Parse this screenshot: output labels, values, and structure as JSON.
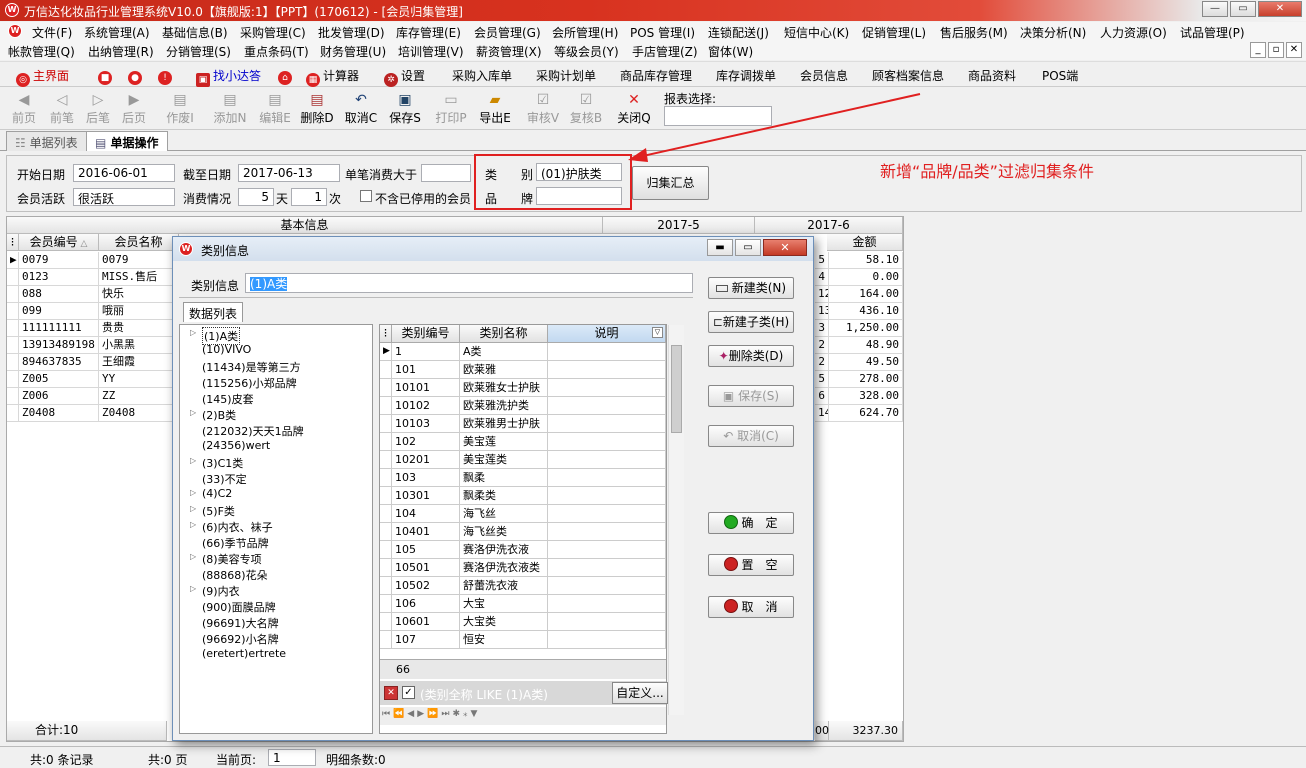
{
  "window": {
    "title": "万信达化妆品行业管理系统V10.0【旗舰版:1】【PPT】(170612) - [会员归集管理]",
    "controls": [
      "—",
      "▭",
      "✕"
    ]
  },
  "menu1": [
    "文件(F)",
    "系统管理(A)",
    "基础信息(B)",
    "采购管理(C)",
    "批发管理(D)",
    "库存管理(E)",
    "会员管理(G)",
    "会所管理(H)",
    "POS 管理(I)",
    "连锁配送(J)",
    "短信中心(K)",
    "促销管理(L)",
    "售后服务(M)",
    "决策分析(N)",
    "人力资源(O)",
    "试品管理(P)"
  ],
  "menu2": [
    "帐款管理(Q)",
    "出纳管理(R)",
    "分销管理(S)",
    "重点条码(T)",
    "财务管理(U)",
    "培训管理(V)",
    "薪资管理(X)",
    "等级会员(Y)",
    "手店管理(Z)",
    "窗体(W)"
  ],
  "mdi_controls": [
    "_",
    "▫",
    "✕"
  ],
  "quickbar": [
    "主界面",
    "找小达答",
    "计算器",
    "设置",
    "采购入库单",
    "采购计划单",
    "商品库存管理",
    "库存调拨单",
    "会员信息",
    "顾客档案信息",
    "商品资料",
    "POS端"
  ],
  "toolbar": {
    "buttons": [
      "前页",
      "前笔",
      "后笔",
      "后页",
      "作废I",
      "添加N",
      "编辑E",
      "删除D",
      "取消C",
      "保存S",
      "打印P",
      "导出E",
      "审核V",
      "复核B",
      "关闭Q"
    ],
    "report_label": "报表选择:"
  },
  "tabs": [
    "单据列表",
    "单据操作"
  ],
  "filter": {
    "start_date_label": "开始日期",
    "start_date": "2016-06-01",
    "end_date_label": "截至日期",
    "end_date": "2017-06-13",
    "single_label": "单笔消费大于",
    "single_value": "",
    "active_label": "会员活跃",
    "active_value": "很活跃",
    "consume_label": "消费情况",
    "days_value": "5",
    "days_unit": "天",
    "times_value": "1",
    "times_unit": "次",
    "exclude_label": "不含已停用的会员",
    "category_label": "类　　别",
    "category_value": "(01)护肤类",
    "brand_label": "品　　牌",
    "brand_value": "",
    "summary_button": "归集汇总"
  },
  "annotation": "新增“品牌/品类”过滤归集条件",
  "grid": {
    "group_basic": "基本信息",
    "group_may": "2017-5",
    "group_june": "2017-6",
    "col_member_no": "会员编号",
    "col_member_name": "会员名称",
    "col_amount": "金额",
    "rows": [
      {
        "no": "0079",
        "name": "0079",
        "cnt": "5",
        "amt": "58.10"
      },
      {
        "no": "0123",
        "name": "MISS.售后",
        "cnt": "4",
        "amt": "0.00"
      },
      {
        "no": "088",
        "name": "快乐",
        "cnt": "12",
        "amt": "164.00"
      },
      {
        "no": "099",
        "name": "哦丽",
        "cnt": "13",
        "amt": "436.10"
      },
      {
        "no": "111111111",
        "name": "贵贵",
        "cnt": "3",
        "amt": "1,250.00"
      },
      {
        "no": "13913489198",
        "name": "小黑黑",
        "cnt": "2",
        "amt": "48.90"
      },
      {
        "no": "894637835",
        "name": "王细霞",
        "cnt": "2",
        "amt": "49.50"
      },
      {
        "no": "Z005",
        "name": "YY",
        "cnt": "5",
        "amt": "278.00"
      },
      {
        "no": "Z006",
        "name": "ZZ",
        "cnt": "6",
        "amt": "328.00"
      },
      {
        "no": "Z0408",
        "name": "Z0408",
        "cnt": "14",
        "amt": "624.70"
      }
    ],
    "total_label": "合计:10",
    "total_cnt": "00",
    "total_amt": "3237.30"
  },
  "status": {
    "records": "共:0 条记录",
    "pages": "共:0 页",
    "current_label": "当前页:",
    "current_value": "1",
    "detail": "明细条数:0"
  },
  "dialog": {
    "title": "类别信息",
    "info_label": "类别信息",
    "info_value": "(1)A类",
    "tab": "数据列表",
    "tree": [
      "(1)A类",
      "(10)VIVO",
      "(11434)是等第三方",
      "(115256)小郑品牌",
      "(145)皮套",
      "(2)B类",
      "(212032)天天1品牌",
      "(24356)wert",
      "(3)C1类",
      "(33)不定",
      "(4)C2",
      "(5)F类",
      "(6)内衣、袜子",
      "(66)季节品牌",
      "(8)美容专项",
      "(88868)花朵",
      "(9)内衣",
      "(900)面膜品牌",
      "(96691)大名牌",
      "(96692)小名牌",
      "(eretert)ertrete"
    ],
    "col_code": "类别编号",
    "col_name": "类别名称",
    "col_desc": "说明",
    "rows": [
      {
        "code": "1",
        "name": "A类"
      },
      {
        "code": "101",
        "name": "欧莱雅"
      },
      {
        "code": "10101",
        "name": "欧莱雅女士护肤"
      },
      {
        "code": "10102",
        "name": "欧莱雅洗护类"
      },
      {
        "code": "10103",
        "name": "欧莱雅男士护肤"
      },
      {
        "code": "102",
        "name": "美宝莲"
      },
      {
        "code": "10201",
        "name": "美宝莲类"
      },
      {
        "code": "103",
        "name": "飘柔"
      },
      {
        "code": "10301",
        "name": "飘柔类"
      },
      {
        "code": "104",
        "name": "海飞丝"
      },
      {
        "code": "10401",
        "name": "海飞丝类"
      },
      {
        "code": "105",
        "name": "赛洛伊洗衣液"
      },
      {
        "code": "10501",
        "name": "赛洛伊洗衣液类"
      },
      {
        "code": "10502",
        "name": "舒蕾洗衣液"
      },
      {
        "code": "106",
        "name": "大宝"
      },
      {
        "code": "10601",
        "name": "大宝类"
      },
      {
        "code": "107",
        "name": "恒安"
      }
    ],
    "count": "66",
    "filter_text": "(类别全称 LIKE (1)A类)",
    "custom_button": "自定义...",
    "buttons": {
      "new_class": "新建类(N)",
      "new_sub": "新建子类(H)",
      "delete": "删除类(D)",
      "save": "保存(S)",
      "cancel": "取消(C)",
      "ok": "确　定",
      "clear": "置　空",
      "close": "取　消"
    }
  }
}
